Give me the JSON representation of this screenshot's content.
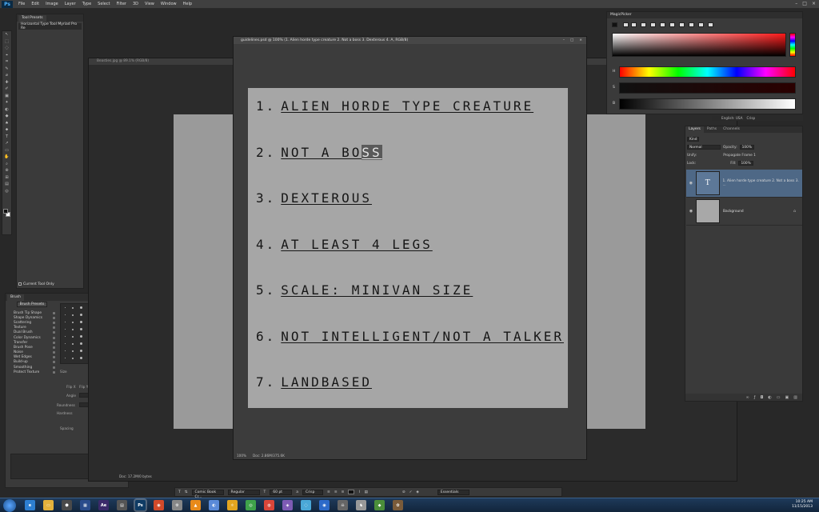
{
  "app": {
    "logo": "Ps",
    "menu": [
      "File",
      "Edit",
      "Image",
      "Layer",
      "Type",
      "Select",
      "Filter",
      "3D",
      "View",
      "Window",
      "Help"
    ],
    "window_controls": [
      "–",
      "□",
      "×"
    ]
  },
  "tools": [
    "↖",
    "⬚",
    "◌",
    "⌖",
    "⌗",
    "✎",
    "⌀",
    "✚",
    "✐",
    "▣",
    "✦",
    "◐",
    "◆",
    "♠",
    "⬥",
    "T",
    "↗",
    "▭",
    "✋",
    "⌕",
    "⊕",
    "⊞",
    "▤",
    "◎"
  ],
  "tool_presets": {
    "tab": "Tool Presets",
    "item": "Horizontal Type Tool Myriad Pro Re",
    "footer_label": "Current Tool Only"
  },
  "brush": {
    "tab": "Brush",
    "presets_button": "Brush Presets",
    "options": [
      "Brush Tip Shape",
      "Shape Dynamics",
      "Scattering",
      "Texture",
      "Dual Brush",
      "Color Dynamics",
      "Transfer",
      "Brush Pose",
      "Noise",
      "Wet Edges",
      "Build-up",
      "Smoothing",
      "Protect Texture"
    ],
    "size_label": "Size",
    "flip_x": "Flip X",
    "flip_y": "Flip Y",
    "angle_label": "Angle",
    "roundness_label": "Roundness",
    "hardness_label": "Hardness",
    "spacing_label": "Spacing"
  },
  "doc_back": {
    "title": "Beasties.jpg @ 89.1% (RGB/8)",
    "status": "Doc: 17.2M/0 bytes"
  },
  "doc_front": {
    "title": "guidelines.psd @ 100% (1. Alien horde type creature  2. Not a boss  3. Dexterous  4. A, RGB/8)",
    "zoom": "100%",
    "doc_size": "Doc: 2.86M/375.6K",
    "lines": [
      {
        "num": "1.",
        "text": "ALIEN HORDE TYPE CREATURE"
      },
      {
        "num": "2.",
        "text": "NOT A BO",
        "sel": "SS"
      },
      {
        "num": "3.",
        "text": "DEXTEROUS"
      },
      {
        "num": "4.",
        "text": "AT LEAST 4 LEGS"
      },
      {
        "num": "5.",
        "text": "SCALE: MINIVAN SIZE"
      },
      {
        "num": "6.",
        "text": "NOT INTELLIGENT/NOT A TALKER"
      },
      {
        "num": "7.",
        "text": "LANDBASED"
      }
    ]
  },
  "color_panel": {
    "tab": "MagicPicker",
    "h": "H",
    "s": "S",
    "b": "B"
  },
  "lang_strip": {
    "language": "English: USA",
    "mode": "Crisp"
  },
  "layers": {
    "tabs": [
      "Layers",
      "Paths",
      "Channels"
    ],
    "kind": "Kind",
    "blend": "Normal",
    "opacity_label": "Opacity:",
    "opacity_value": "100%",
    "lock_label": "Lock:",
    "fill_label": "Fill:",
    "fill_value": "100%",
    "unify_label": "Unify:",
    "propagate_label": "Propagate Frame 1",
    "items": [
      {
        "name": "1. Alien horde type creature  2. Not a boss  3. ...",
        "thumb": "T"
      },
      {
        "name": "Background",
        "thumb": ""
      }
    ]
  },
  "options_bar": {
    "font_family": "Comic Book Cr...",
    "font_style": "Regular",
    "font_size": "60 pt",
    "aa_label": "a",
    "aa_mode": "Crisp",
    "workspace": "Essentials"
  },
  "taskbar": {
    "apps": [
      {
        "label": "e",
        "color": "#2d7fd1"
      },
      {
        "label": "▭",
        "color": "#e2b13c"
      },
      {
        "label": "⬢",
        "color": "#4a4a4a"
      },
      {
        "label": "▦",
        "color": "#2a4c8c"
      },
      {
        "label": "Ae",
        "color": "#3b2a6a"
      },
      {
        "label": "▤",
        "color": "#555"
      },
      {
        "label": "Ps",
        "color": "#0f3b64"
      },
      {
        "label": "◉",
        "color": "#d24a2a"
      },
      {
        "label": "⚙",
        "color": "#888"
      },
      {
        "label": "▲",
        "color": "#e88a1a"
      },
      {
        "label": "◐",
        "color": "#5a8ad8"
      },
      {
        "label": "⚛",
        "color": "#e2a51f"
      },
      {
        "label": "◎",
        "color": "#3fa24a"
      },
      {
        "label": "◍",
        "color": "#d9463a"
      },
      {
        "label": "◈",
        "color": "#7e5bb4"
      },
      {
        "label": "◌",
        "color": "#4aa8d8"
      },
      {
        "label": "◉",
        "color": "#2d6ac9"
      },
      {
        "label": "☠",
        "color": "#666"
      },
      {
        "label": "♞",
        "color": "#999"
      },
      {
        "label": "◆",
        "color": "#4b8e3a"
      },
      {
        "label": "✿",
        "color": "#7a5b3a"
      }
    ],
    "time": "10:25 AM",
    "date": "11/15/2013"
  }
}
